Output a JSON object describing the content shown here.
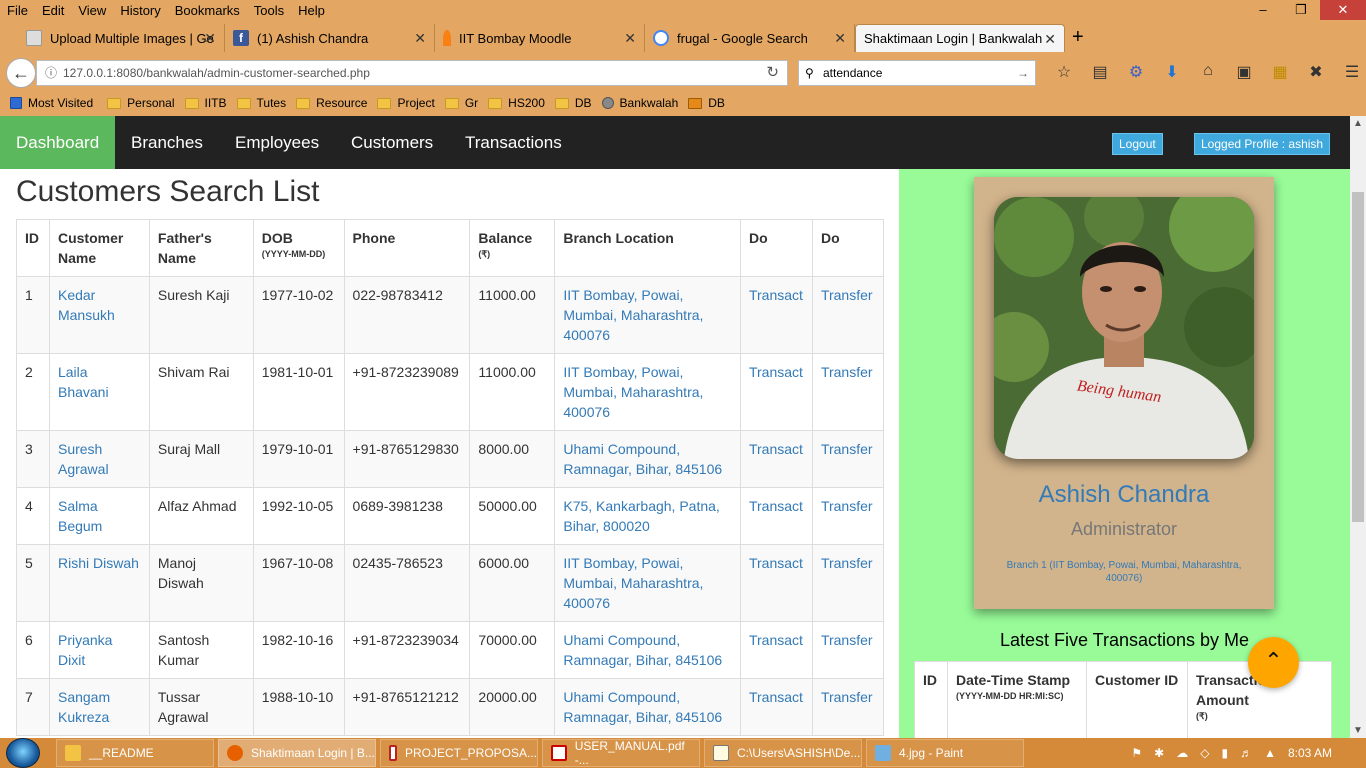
{
  "browser": {
    "menu": [
      "File",
      "Edit",
      "View",
      "History",
      "Bookmarks",
      "Tools",
      "Help"
    ],
    "tabs": [
      {
        "title": "Upload Multiple Images | Ge"
      },
      {
        "title": "(1) Ashish Chandra"
      },
      {
        "title": "IIT Bombay Moodle"
      },
      {
        "title": "frugal - Google Search"
      },
      {
        "title": "Shaktimaan Login | Bankwalah"
      }
    ],
    "url": "127.0.0.1:8080/bankwalah/admin-customer-searched.php",
    "search_value": "attendance",
    "bookmarks": [
      "Most Visited",
      "Personal",
      "IITB",
      "Tutes",
      "Resource",
      "Project",
      "Gr",
      "HS200",
      "DB",
      "Bankwalah",
      "DB"
    ]
  },
  "nav": {
    "dashboard": "Dashboard",
    "branches": "Branches",
    "employees": "Employees",
    "customers": "Customers",
    "transactions": "Transactions",
    "logout": "Logout",
    "profile": "Logged Profile : ashish"
  },
  "page": {
    "title": "Customers Search List",
    "headers": {
      "id": "ID",
      "name": "Customer Name",
      "father": "Father's Name",
      "dob": "DOB",
      "dob_fmt": "(YYYY-MM-DD)",
      "phone": "Phone",
      "balance": "Balance",
      "balance_unit": "(₹)",
      "branch": "Branch Location",
      "do1": "Do",
      "do2": "Do"
    },
    "customers": [
      {
        "id": "1",
        "name": "Kedar Mansukh",
        "father": "Suresh Kaji",
        "dob": "1977-10-02",
        "phone": "022-98783412",
        "balance": "11000.00",
        "branch": "IIT Bombay, Powai, Mumbai, Maharashtra, 400076"
      },
      {
        "id": "2",
        "name": "Laila Bhavani",
        "father": "Shivam Rai",
        "dob": "1981-10-01",
        "phone": "+91-8723239089",
        "balance": "11000.00",
        "branch": "IIT Bombay, Powai, Mumbai, Maharashtra, 400076"
      },
      {
        "id": "3",
        "name": "Suresh Agrawal",
        "father": "Suraj Mall",
        "dob": "1979-10-01",
        "phone": "+91-8765129830",
        "balance": "8000.00",
        "branch": "Uhami Compound, Ramnagar, Bihar, 845106"
      },
      {
        "id": "4",
        "name": "Salma Begum",
        "father": "Alfaz Ahmad",
        "dob": "1992-10-05",
        "phone": "0689-3981238",
        "balance": "50000.00",
        "branch": "K75, Kankarbagh, Patna, Bihar, 800020"
      },
      {
        "id": "5",
        "name": "Rishi Diswah",
        "father": "Manoj Diswah",
        "dob": "1967-10-08",
        "phone": "02435-786523",
        "balance": "6000.00",
        "branch": "IIT Bombay, Powai, Mumbai, Maharashtra, 400076"
      },
      {
        "id": "6",
        "name": "Priyanka Dixit",
        "father": "Santosh Kumar",
        "dob": "1982-10-16",
        "phone": "+91-8723239034",
        "balance": "70000.00",
        "branch": "Uhami Compound, Ramnagar, Bihar, 845106"
      },
      {
        "id": "7",
        "name": "Sangam Kukreza",
        "father": "Tussar Agrawal",
        "dob": "1988-10-10",
        "phone": "+91-8765121212",
        "balance": "20000.00",
        "branch": "Uhami Compound, Ramnagar, Bihar, 845106"
      }
    ],
    "action_transact": "Transact",
    "action_transfer": "Transfer"
  },
  "profile_card": {
    "name": "Ashish Chandra",
    "role": "Administrator",
    "branch": "Branch 1 (IIT Bombay, Powai, Mumbai, Maharashtra, 400076)",
    "shirt_text": "Being human"
  },
  "transactions_panel": {
    "title": "Latest Five Transactions by Me",
    "headers": {
      "id": "ID",
      "stamp": "Date-Time Stamp",
      "stamp_fmt": "(YYYY-MM-DD HR:MI:SC)",
      "customer": "Customer ID",
      "amount": "Transaction Amount",
      "amount_unit": "(₹)"
    }
  },
  "taskbar": {
    "items": [
      "__README",
      "Shaktimaan Login | B...",
      "PROJECT_PROPOSA...",
      "USER_MANUAL.pdf -...",
      "C:\\Users\\ASHISH\\De...",
      "4.jpg - Paint"
    ],
    "time": "8:03 AM"
  }
}
